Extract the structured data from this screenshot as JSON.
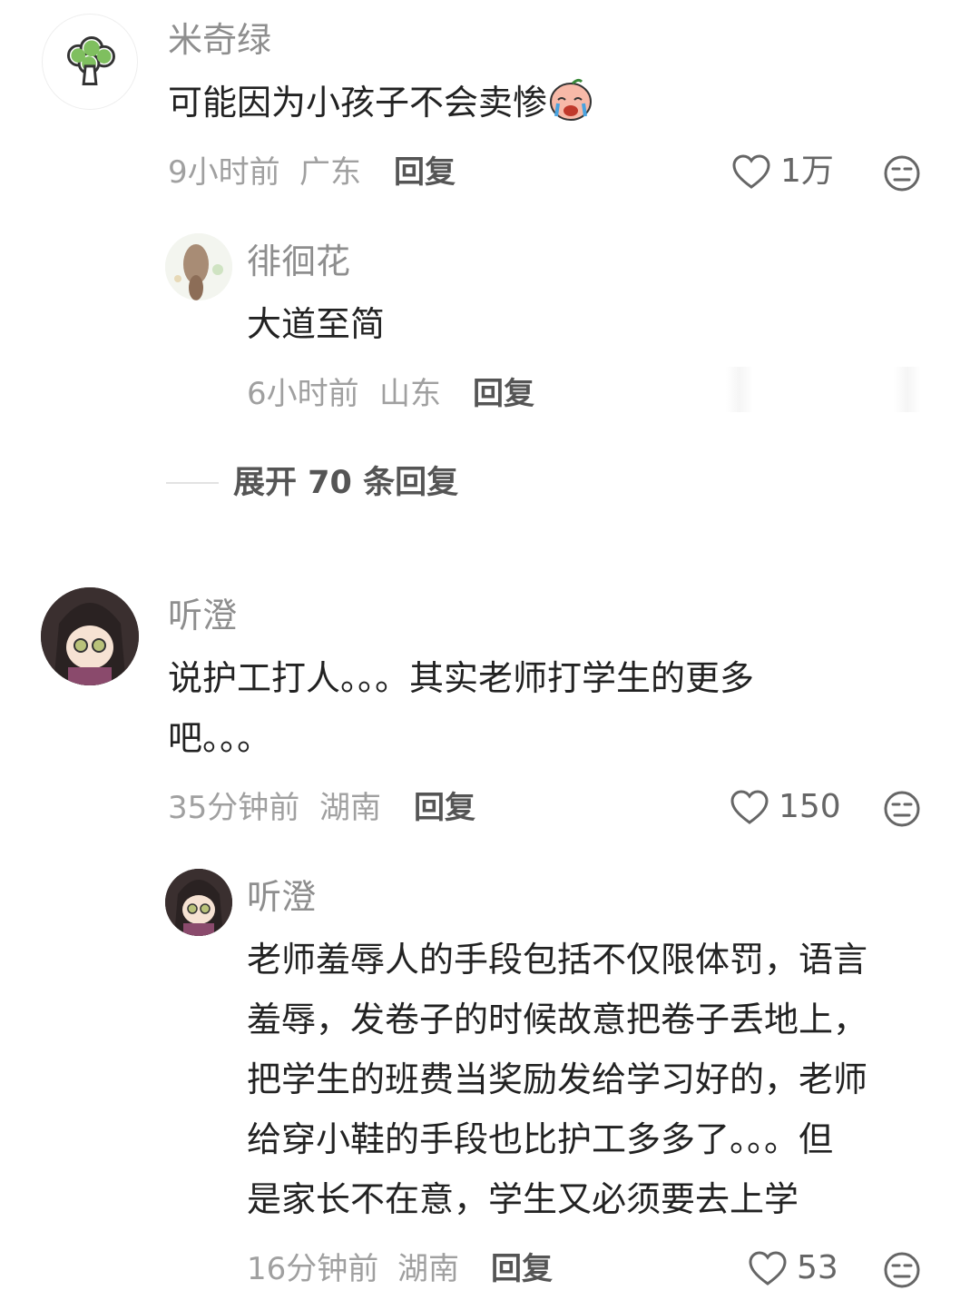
{
  "comments": [
    {
      "username": "米奇绿",
      "avatar_icon": "broccoli-avatar",
      "content": "可能因为小孩子不会卖惨",
      "emoji": "crying-face-emoji",
      "time": "9小时前",
      "location": "广东",
      "reply_label": "回复",
      "likes": "1万",
      "reply": {
        "username": "徘徊花",
        "avatar_icon": "girl-hair-avatar",
        "content": "大道至简",
        "time": "6小时前",
        "location": "山东",
        "reply_label": "回复"
      },
      "expand_label": "展开 70 条回复"
    },
    {
      "username": "听澄",
      "avatar_icon": "anime-character-avatar",
      "content_lines": [
        "说护工打人。。。其实老师打学生的更多",
        "吧。。。"
      ],
      "time": "35分钟前",
      "location": "湖南",
      "reply_label": "回复",
      "likes": "150",
      "reply": {
        "username": "听澄",
        "avatar_icon": "anime-character-avatar",
        "content_lines": [
          "老师羞辱人的手段包括不仅限体罚，语言",
          "羞辱，发卷子的时候故意把卷子丢地上，",
          "把学生的班费当奖励发给学习好的，老师",
          "给穿小鞋的手段也比护工多多了。。。但",
          "是家长不在意，学生又必须要去上学"
        ],
        "time": "16分钟前",
        "location": "湖南",
        "reply_label": "回复",
        "likes": "53"
      }
    }
  ],
  "colors": {
    "username": "#8e8e8e",
    "content": "#222222",
    "meta": "#a0a0a0",
    "reply": "#555555",
    "icon": "#666666"
  }
}
